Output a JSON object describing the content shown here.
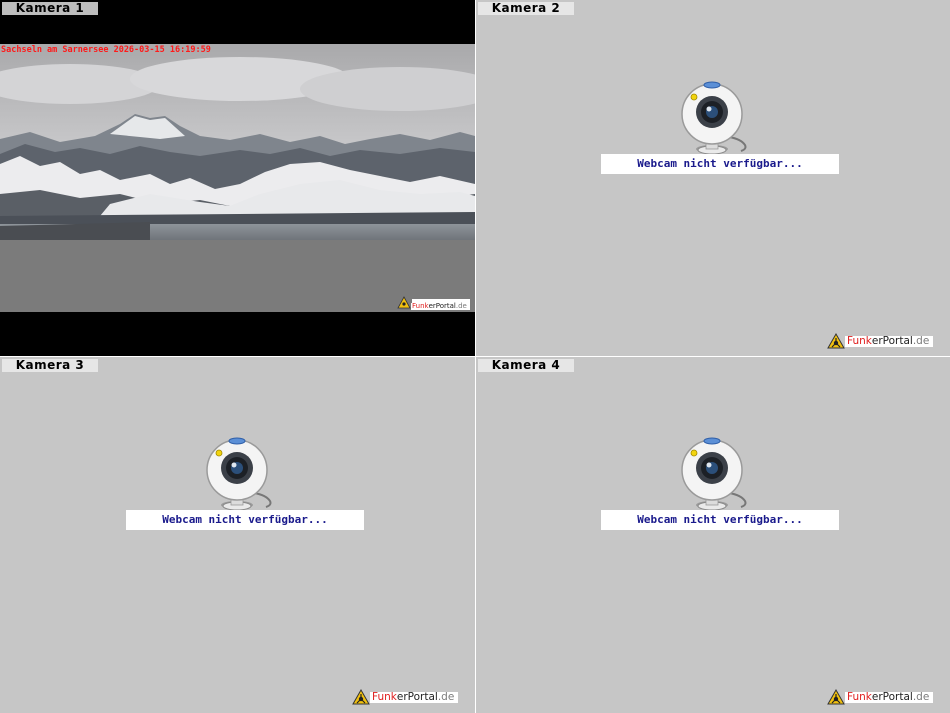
{
  "cameras": [
    {
      "label": "Kamera 1",
      "overlay": "Sachseln am Sarnersee 2026-03-15 16:19:59"
    },
    {
      "label": "Kamera 2",
      "status": "Webcam nicht verfügbar..."
    },
    {
      "label": "Kamera 3",
      "status": "Webcam nicht verfügbar..."
    },
    {
      "label": "Kamera 4",
      "status": "Webcam nicht verfügbar..."
    }
  ],
  "watermark": {
    "part1": "Funk",
    "part2": "er",
    "part3": "Portal",
    "part4": ".de"
  },
  "colors": {
    "unavailable_bg": "#c6c6c6",
    "status_text": "#1a1a8c",
    "overlay_text": "#ff1a1a",
    "brand_red": "#e02020"
  },
  "icons": [
    "webcam-icon",
    "warning-triangle-logo-icon"
  ]
}
